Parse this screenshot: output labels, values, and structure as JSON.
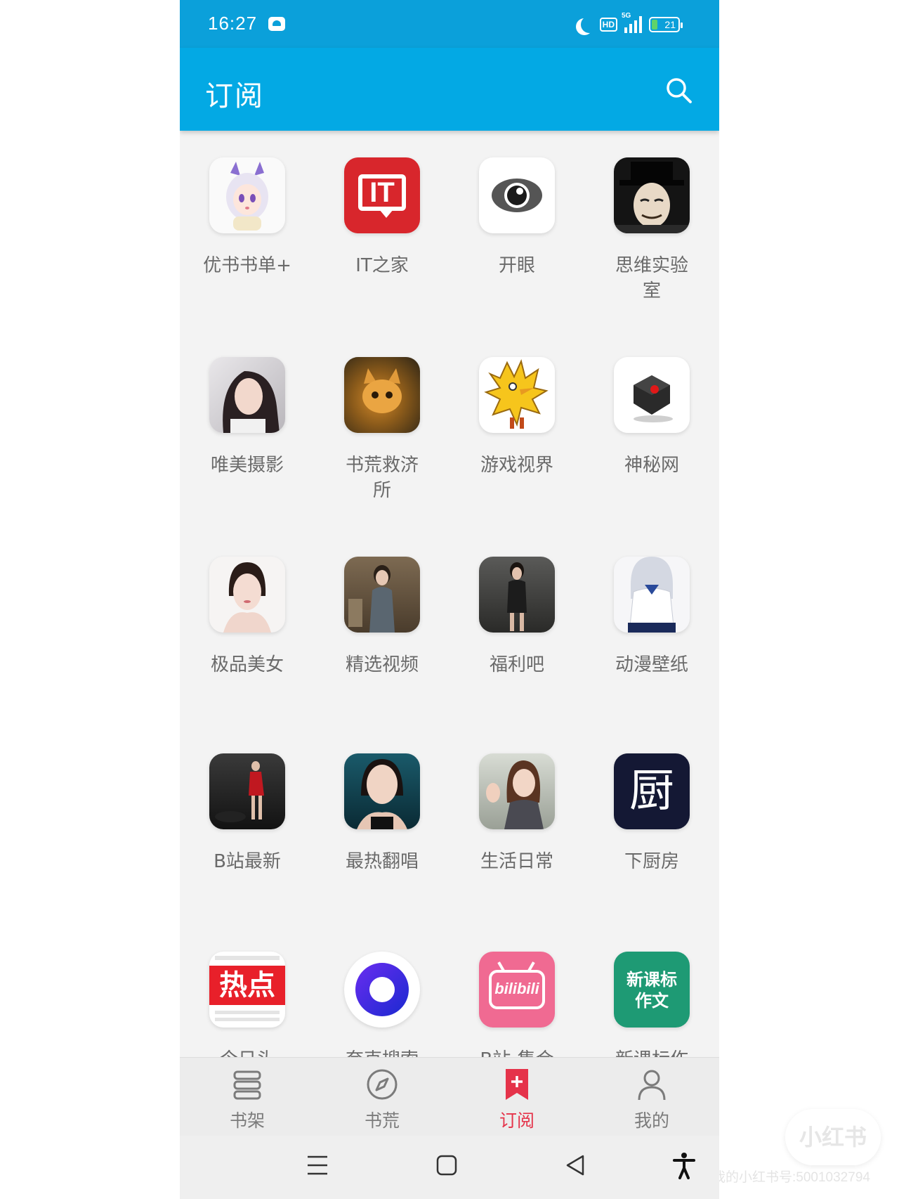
{
  "status_bar": {
    "time": "16:27",
    "network": "5G",
    "hd_badge": "HD",
    "battery": "21"
  },
  "app_bar": {
    "title": "订阅"
  },
  "subscriptions": [
    {
      "label": "优书书单+",
      "icon": "anime-girl-icon"
    },
    {
      "label": "IT之家",
      "icon": "it-home-logo-icon"
    },
    {
      "label": "开眼",
      "icon": "eye-icon"
    },
    {
      "label": "思维实验室",
      "icon": "mask-man-icon"
    },
    {
      "label": "唯美摄影",
      "icon": "portrait-photo-icon"
    },
    {
      "label": "书荒救济所",
      "icon": "cat-photo-icon"
    },
    {
      "label": "游戏视界",
      "icon": "chocobo-icon"
    },
    {
      "label": "神秘网",
      "icon": "cube-icon"
    },
    {
      "label": "极品美女",
      "icon": "woman-portrait-icon"
    },
    {
      "label": "精选视频",
      "icon": "woman-dress-photo-icon"
    },
    {
      "label": "福利吧",
      "icon": "woman-street-photo-icon"
    },
    {
      "label": "动漫壁纸",
      "icon": "anime-uniform-icon"
    },
    {
      "label": "B站最新",
      "icon": "dancer-photo-icon"
    },
    {
      "label": "最热翻唱",
      "icon": "girl-face-photo-icon"
    },
    {
      "label": "生活日常",
      "icon": "girl-waving-photo-icon"
    },
    {
      "label": "下厨房",
      "icon": "kitchen-logo-icon"
    },
    {
      "label": "今日头",
      "icon": "hot-news-logo-icon"
    },
    {
      "label": "夸克搜索",
      "icon": "quark-logo-icon"
    },
    {
      "label": "B站-集合",
      "icon": "bilibili-logo-icon"
    },
    {
      "label": "新课标作",
      "icon": "new-curriculum-logo-icon"
    }
  ],
  "icon_text": {
    "it_home": "IT",
    "kitchen": "厨",
    "hot": "热点",
    "bilibili": "bilibili",
    "curriculum_line1": "新课标",
    "curriculum_line2": "作文"
  },
  "bottom_nav": [
    {
      "label": "书架",
      "icon": "bookshelf-icon",
      "active": false
    },
    {
      "label": "书荒",
      "icon": "compass-icon",
      "active": false
    },
    {
      "label": "订阅",
      "icon": "bookmark-add-icon",
      "active": true
    },
    {
      "label": "我的",
      "icon": "person-icon",
      "active": false
    }
  ],
  "watermark": {
    "brand": "小红书",
    "account": "我的小红书号:5001032794"
  },
  "colors": {
    "status_bar": "#0ba0da",
    "app_bar": "#03a9e4",
    "active_tab": "#e5334a",
    "background": "#f3f3f3"
  }
}
